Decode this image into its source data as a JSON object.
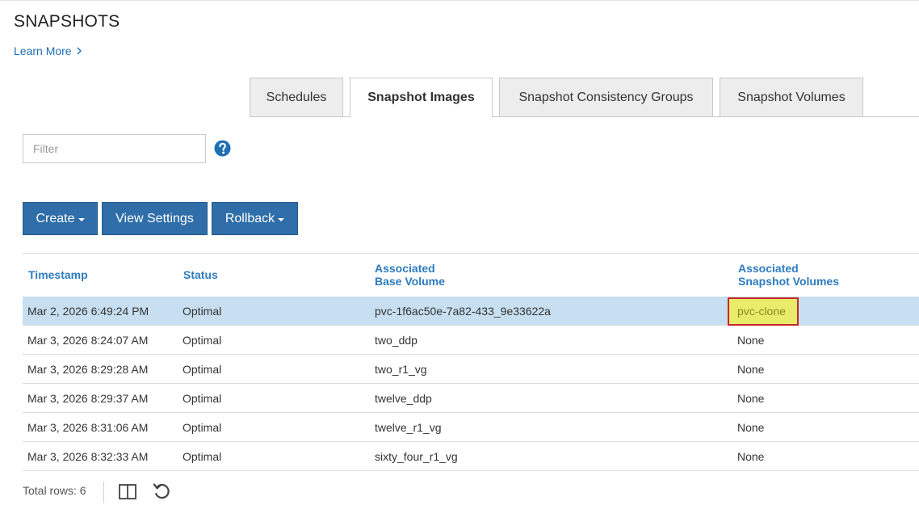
{
  "page": {
    "title": "SNAPSHOTS",
    "learn_more": "Learn More"
  },
  "tabs": [
    {
      "label": "Schedules",
      "active": false
    },
    {
      "label": "Snapshot Images",
      "active": true
    },
    {
      "label": "Snapshot Consistency Groups",
      "active": false
    },
    {
      "label": "Snapshot Volumes",
      "active": false
    }
  ],
  "filter": {
    "placeholder": "Filter",
    "value": ""
  },
  "toolbar": {
    "create_label": "Create",
    "view_settings_label": "View Settings",
    "rollback_label": "Rollback"
  },
  "table": {
    "headers": {
      "timestamp": "Timestamp",
      "status": "Status",
      "base_volume_line1": "Associated",
      "base_volume_line2": "Base Volume",
      "snapshot_volumes_line1": "Associated",
      "snapshot_volumes_line2": "Snapshot Volumes"
    },
    "rows": [
      {
        "timestamp": "Mar 2, 2026 6:49:24 PM",
        "status": "Optimal",
        "base_volume": "pvc-1f6ac50e-7a82-433_9e33622a",
        "snapshot_volumes": "pvc-clone"
      },
      {
        "timestamp": "Mar 3, 2026 8:24:07 AM",
        "status": "Optimal",
        "base_volume": "two_ddp",
        "snapshot_volumes": "None"
      },
      {
        "timestamp": "Mar 3, 2026 8:29:28 AM",
        "status": "Optimal",
        "base_volume": "two_r1_vg",
        "snapshot_volumes": "None"
      },
      {
        "timestamp": "Mar 3, 2026 8:29:37 AM",
        "status": "Optimal",
        "base_volume": "twelve_ddp",
        "snapshot_volumes": "None"
      },
      {
        "timestamp": "Mar 3, 2026 8:31:06 AM",
        "status": "Optimal",
        "base_volume": "twelve_r1_vg",
        "snapshot_volumes": "None"
      },
      {
        "timestamp": "Mar 3, 2026 8:32:33 AM",
        "status": "Optimal",
        "base_volume": "sixty_four_r1_vg",
        "snapshot_volumes": "None"
      }
    ],
    "selected_row": 0
  },
  "footer": {
    "total_rows": "Total rows: 6"
  },
  "colors": {
    "primary_button": "#2f6ea8",
    "link": "#1f6fb2",
    "header_text": "#2e7bbf",
    "selected_row": "#c7dff0",
    "highlight_fill": "#e8ec6a",
    "highlight_border": "#c62828"
  },
  "icons": {
    "help": "question-circle-icon",
    "columns": "columns-icon",
    "refresh": "refresh-icon",
    "learn_more_chevron": "chevron-right-icon"
  }
}
